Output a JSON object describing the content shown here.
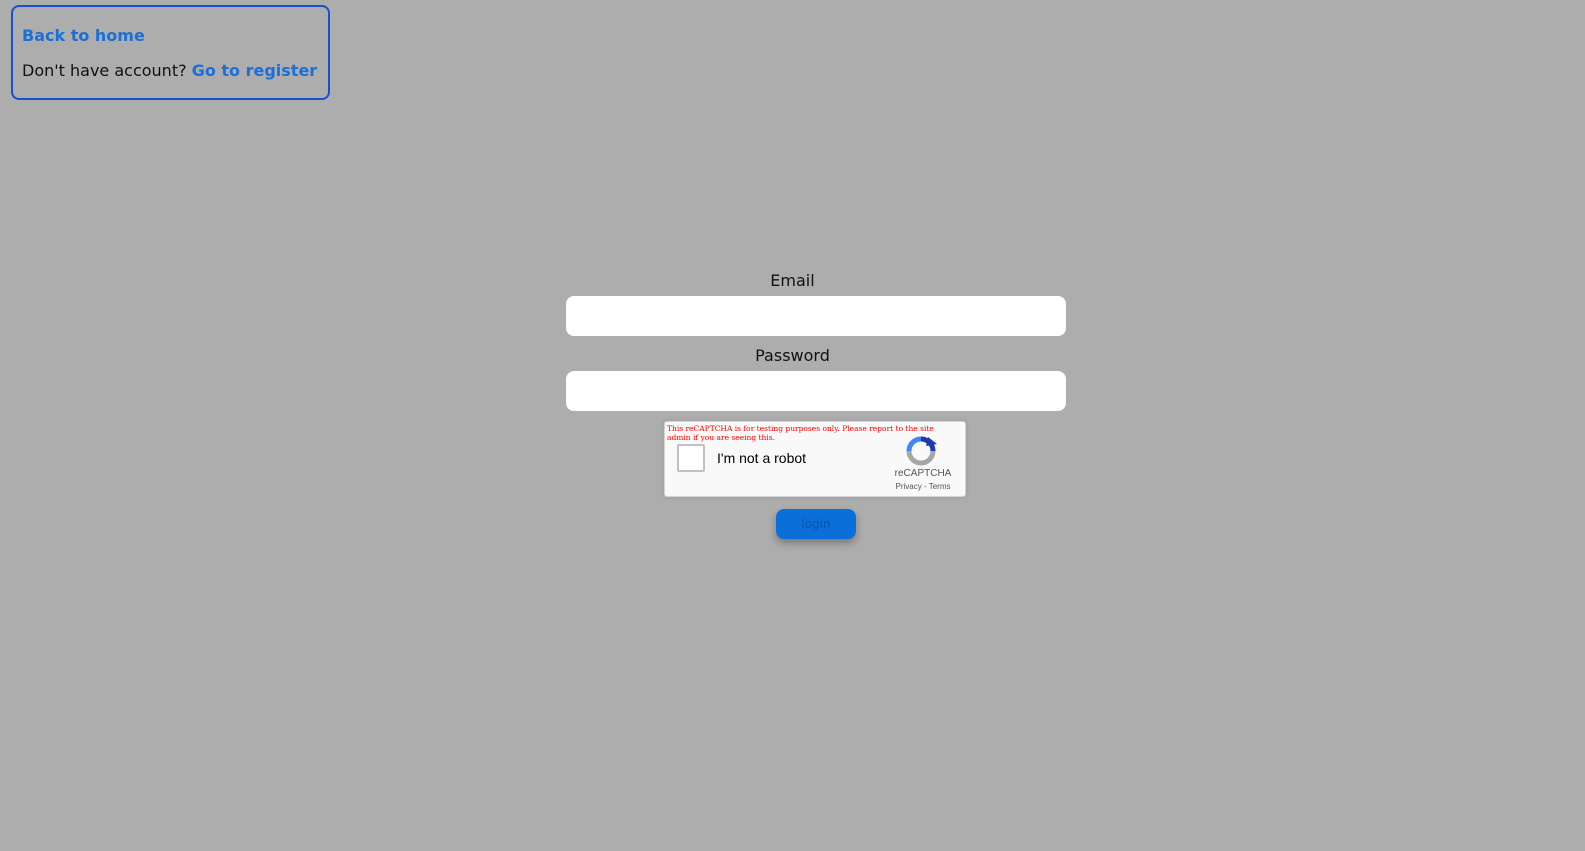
{
  "nav": {
    "home_link": "Back to home",
    "register_prompt": "Don't have account?",
    "register_link": "Go to register"
  },
  "form": {
    "email_label": "Email",
    "email_value": "",
    "password_label": "Password",
    "password_value": "",
    "login_label": "login"
  },
  "recaptcha": {
    "warning": "This reCAPTCHA is for testing purposes only. Please report to the site admin if you are seeing this.",
    "checkbox_label": "I'm not a robot",
    "brand": "reCAPTCHA",
    "privacy": "Privacy",
    "separator": "-",
    "terms": "Terms",
    "checked": false
  },
  "colors": {
    "background": "#adadad",
    "link": "#1a6fd8",
    "nav_border": "#1a4fcf",
    "button": "#0a6fd8"
  }
}
